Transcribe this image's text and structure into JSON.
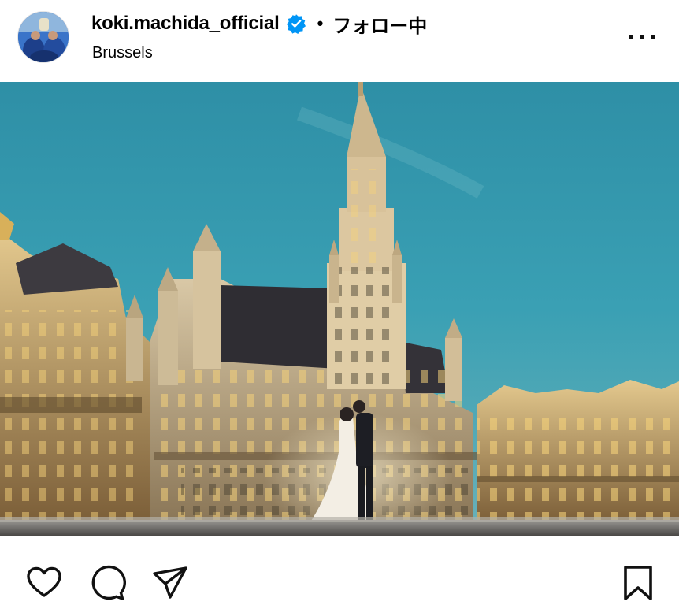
{
  "post": {
    "username": "koki.machida_official",
    "separator": "•",
    "follow_status": "フォロー中",
    "location": "Brussels"
  },
  "icons": {
    "verified": "verified-badge-icon",
    "more": "more-options-icon",
    "like": "heart-icon",
    "comment": "comment-icon",
    "share": "share-icon",
    "save": "bookmark-icon"
  },
  "colors": {
    "verified": "#0095f6",
    "sky": "#3d9db0",
    "text": "#000000"
  }
}
